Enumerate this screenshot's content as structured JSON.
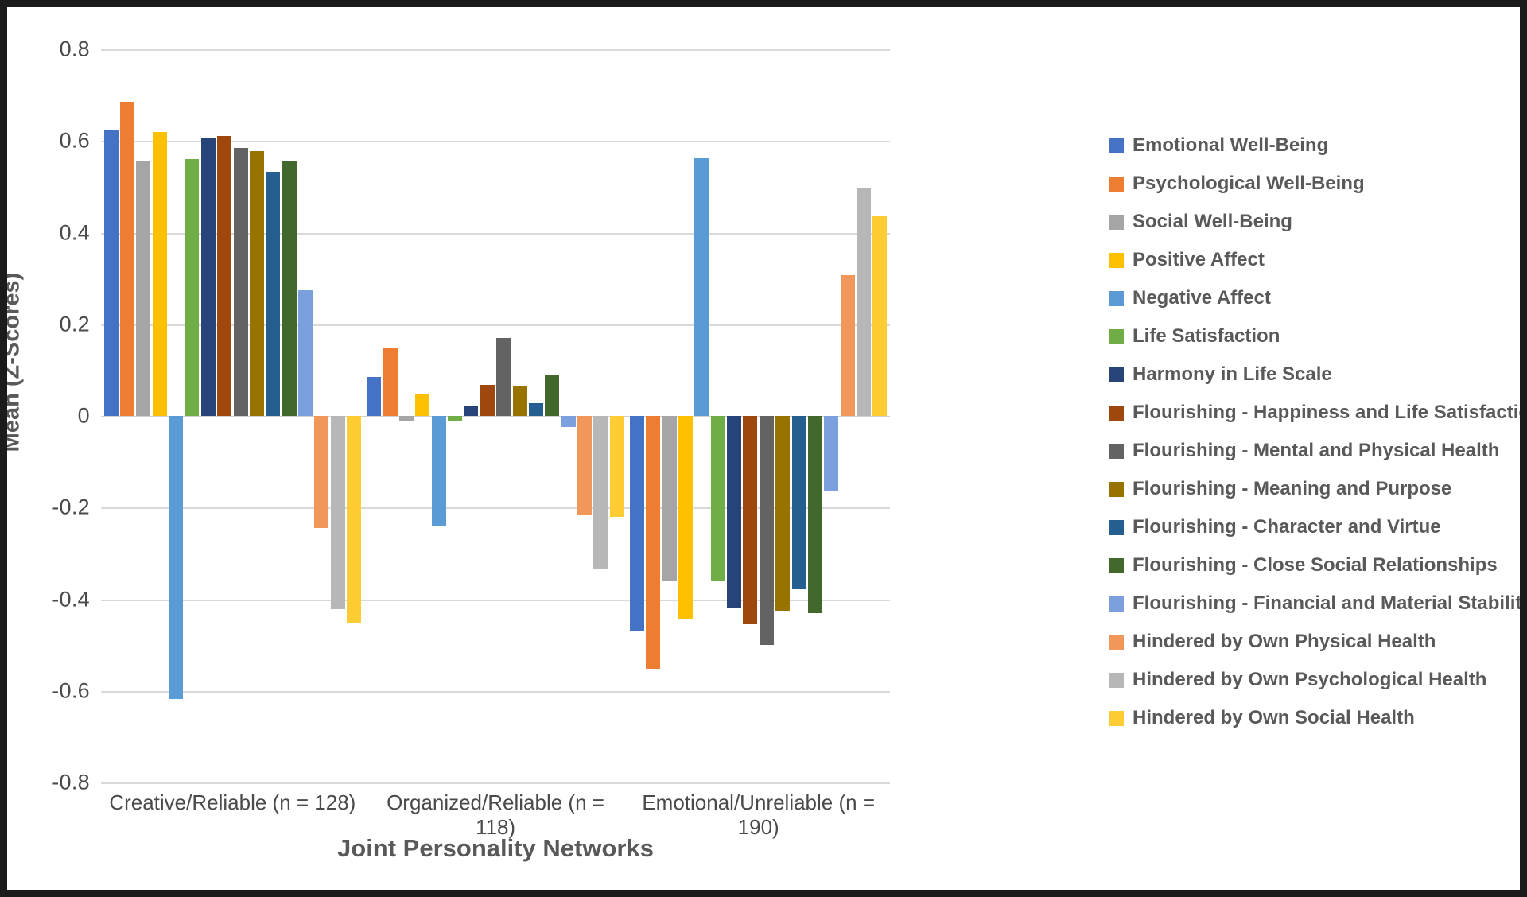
{
  "chart_data": {
    "type": "bar",
    "title": "",
    "xlabel": "Joint Personality Networks",
    "ylabel": "Mean (Z-Scores)",
    "ylim": [
      -0.8,
      0.8
    ],
    "yticks": [
      "0.8",
      "0.6",
      "0.4",
      "0.2",
      "0",
      "-0.2",
      "-0.4",
      "-0.6",
      "-0.8"
    ],
    "ytick_values": [
      0.8,
      0.6,
      0.4,
      0.2,
      0,
      -0.2,
      -0.4,
      -0.6,
      -0.8
    ],
    "grid": true,
    "legend_position": "right",
    "categories": [
      "Creative/Reliable (n = 128)",
      "Organized/Reliable (n = 118)",
      "Emotional/Unreliable (n = 190)"
    ],
    "series": [
      {
        "name": "Emotional Well-Being",
        "color": "#4472c4",
        "values": [
          0.625,
          0.085,
          -0.468
        ]
      },
      {
        "name": "Psychological Well-Being",
        "color": "#ed7d31",
        "values": [
          0.685,
          0.148,
          -0.552
        ]
      },
      {
        "name": "Social Well-Being",
        "color": "#a5a5a5",
        "values": [
          0.556,
          -0.012,
          -0.36
        ]
      },
      {
        "name": "Positive Affect",
        "color": "#ffc000",
        "values": [
          0.62,
          0.047,
          -0.445
        ]
      },
      {
        "name": "Negative Affect",
        "color": "#5b9bd5",
        "values": [
          -0.618,
          -0.24,
          0.562
        ]
      },
      {
        "name": "Life Satisfaction",
        "color": "#70ad47",
        "values": [
          0.56,
          -0.012,
          -0.36
        ]
      },
      {
        "name": "Harmony in Life Scale",
        "color": "#264478",
        "values": [
          0.608,
          0.022,
          -0.42
        ]
      },
      {
        "name": "Flourishing - Happiness and Life Satisfaction",
        "color": "#9e480e",
        "values": [
          0.61,
          0.068,
          -0.455
        ]
      },
      {
        "name": "Flourishing - Mental and Physical Health",
        "color": "#636363",
        "values": [
          0.585,
          0.17,
          -0.5
        ]
      },
      {
        "name": "Flourishing - Meaning and Purpose",
        "color": "#997300",
        "values": [
          0.578,
          0.065,
          -0.425
        ]
      },
      {
        "name": "Flourishing - Character and Virtue",
        "color": "#255e91",
        "values": [
          0.533,
          0.028,
          -0.378
        ]
      },
      {
        "name": "Flourishing - Close Social Relationships",
        "color": "#43682b",
        "values": [
          0.555,
          0.09,
          -0.43
        ]
      },
      {
        "name": "Flourishing - Financial and Material Stability",
        "color": "#7c9fdd",
        "values": [
          0.275,
          -0.025,
          -0.165
        ]
      },
      {
        "name": "Hindered by Own Physical Health",
        "color": "#f1975a",
        "values": [
          -0.245,
          -0.215,
          0.307
        ]
      },
      {
        "name": "Hindered by Own Psychological Health",
        "color": "#b7b7b7",
        "values": [
          -0.422,
          -0.335,
          0.497
        ]
      },
      {
        "name": "Hindered by Own Social Health",
        "color": "#ffcd33",
        "values": [
          -0.452,
          -0.22,
          0.438
        ]
      }
    ]
  }
}
